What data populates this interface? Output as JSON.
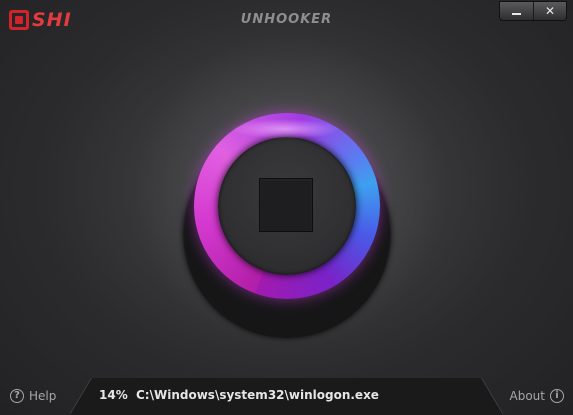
{
  "titlebar": {
    "brand": "SHI",
    "app_title": "UNHOOKER",
    "minimize_label": "",
    "close_label": "✕"
  },
  "main": {
    "action": "stop-button",
    "ring_colors": [
      "#b11ea8",
      "#e060e0",
      "#3ea0f0",
      "#4a5ae8"
    ]
  },
  "status": {
    "progress_percent": "14%",
    "current_file": "C:\\Windows\\system32\\winlogon.exe"
  },
  "footer": {
    "help_label": "Help",
    "help_icon": "?",
    "about_label": "About",
    "about_icon": "i"
  }
}
